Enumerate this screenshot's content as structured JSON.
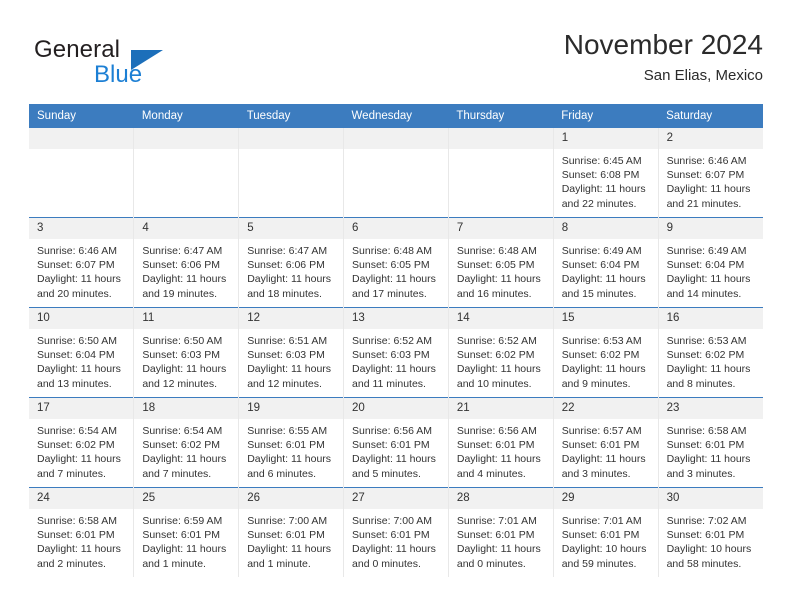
{
  "brand": {
    "name_top": "General",
    "name_bottom": "Blue",
    "triangle_color": "#1c6fba",
    "blue_text_color": "#1c7fd4"
  },
  "header": {
    "title": "November 2024",
    "subtitle": "San Elias, Mexico"
  },
  "theme": {
    "header_blue": "#3c7cbf",
    "daynum_bg": "#f1f1f1",
    "cell_text": "#333333"
  },
  "weekdays": [
    "Sunday",
    "Monday",
    "Tuesday",
    "Wednesday",
    "Thursday",
    "Friday",
    "Saturday"
  ],
  "weeks": [
    [
      {
        "day": "",
        "sunrise": "",
        "sunset": "",
        "daylight1": "",
        "daylight2": ""
      },
      {
        "day": "",
        "sunrise": "",
        "sunset": "",
        "daylight1": "",
        "daylight2": ""
      },
      {
        "day": "",
        "sunrise": "",
        "sunset": "",
        "daylight1": "",
        "daylight2": ""
      },
      {
        "day": "",
        "sunrise": "",
        "sunset": "",
        "daylight1": "",
        "daylight2": ""
      },
      {
        "day": "",
        "sunrise": "",
        "sunset": "",
        "daylight1": "",
        "daylight2": ""
      },
      {
        "day": "1",
        "sunrise": "Sunrise: 6:45 AM",
        "sunset": "Sunset: 6:08 PM",
        "daylight1": "Daylight: 11 hours",
        "daylight2": "and 22 minutes."
      },
      {
        "day": "2",
        "sunrise": "Sunrise: 6:46 AM",
        "sunset": "Sunset: 6:07 PM",
        "daylight1": "Daylight: 11 hours",
        "daylight2": "and 21 minutes."
      }
    ],
    [
      {
        "day": "3",
        "sunrise": "Sunrise: 6:46 AM",
        "sunset": "Sunset: 6:07 PM",
        "daylight1": "Daylight: 11 hours",
        "daylight2": "and 20 minutes."
      },
      {
        "day": "4",
        "sunrise": "Sunrise: 6:47 AM",
        "sunset": "Sunset: 6:06 PM",
        "daylight1": "Daylight: 11 hours",
        "daylight2": "and 19 minutes."
      },
      {
        "day": "5",
        "sunrise": "Sunrise: 6:47 AM",
        "sunset": "Sunset: 6:06 PM",
        "daylight1": "Daylight: 11 hours",
        "daylight2": "and 18 minutes."
      },
      {
        "day": "6",
        "sunrise": "Sunrise: 6:48 AM",
        "sunset": "Sunset: 6:05 PM",
        "daylight1": "Daylight: 11 hours",
        "daylight2": "and 17 minutes."
      },
      {
        "day": "7",
        "sunrise": "Sunrise: 6:48 AM",
        "sunset": "Sunset: 6:05 PM",
        "daylight1": "Daylight: 11 hours",
        "daylight2": "and 16 minutes."
      },
      {
        "day": "8",
        "sunrise": "Sunrise: 6:49 AM",
        "sunset": "Sunset: 6:04 PM",
        "daylight1": "Daylight: 11 hours",
        "daylight2": "and 15 minutes."
      },
      {
        "day": "9",
        "sunrise": "Sunrise: 6:49 AM",
        "sunset": "Sunset: 6:04 PM",
        "daylight1": "Daylight: 11 hours",
        "daylight2": "and 14 minutes."
      }
    ],
    [
      {
        "day": "10",
        "sunrise": "Sunrise: 6:50 AM",
        "sunset": "Sunset: 6:04 PM",
        "daylight1": "Daylight: 11 hours",
        "daylight2": "and 13 minutes."
      },
      {
        "day": "11",
        "sunrise": "Sunrise: 6:50 AM",
        "sunset": "Sunset: 6:03 PM",
        "daylight1": "Daylight: 11 hours",
        "daylight2": "and 12 minutes."
      },
      {
        "day": "12",
        "sunrise": "Sunrise: 6:51 AM",
        "sunset": "Sunset: 6:03 PM",
        "daylight1": "Daylight: 11 hours",
        "daylight2": "and 12 minutes."
      },
      {
        "day": "13",
        "sunrise": "Sunrise: 6:52 AM",
        "sunset": "Sunset: 6:03 PM",
        "daylight1": "Daylight: 11 hours",
        "daylight2": "and 11 minutes."
      },
      {
        "day": "14",
        "sunrise": "Sunrise: 6:52 AM",
        "sunset": "Sunset: 6:02 PM",
        "daylight1": "Daylight: 11 hours",
        "daylight2": "and 10 minutes."
      },
      {
        "day": "15",
        "sunrise": "Sunrise: 6:53 AM",
        "sunset": "Sunset: 6:02 PM",
        "daylight1": "Daylight: 11 hours",
        "daylight2": "and 9 minutes."
      },
      {
        "day": "16",
        "sunrise": "Sunrise: 6:53 AM",
        "sunset": "Sunset: 6:02 PM",
        "daylight1": "Daylight: 11 hours",
        "daylight2": "and 8 minutes."
      }
    ],
    [
      {
        "day": "17",
        "sunrise": "Sunrise: 6:54 AM",
        "sunset": "Sunset: 6:02 PM",
        "daylight1": "Daylight: 11 hours",
        "daylight2": "and 7 minutes."
      },
      {
        "day": "18",
        "sunrise": "Sunrise: 6:54 AM",
        "sunset": "Sunset: 6:02 PM",
        "daylight1": "Daylight: 11 hours",
        "daylight2": "and 7 minutes."
      },
      {
        "day": "19",
        "sunrise": "Sunrise: 6:55 AM",
        "sunset": "Sunset: 6:01 PM",
        "daylight1": "Daylight: 11 hours",
        "daylight2": "and 6 minutes."
      },
      {
        "day": "20",
        "sunrise": "Sunrise: 6:56 AM",
        "sunset": "Sunset: 6:01 PM",
        "daylight1": "Daylight: 11 hours",
        "daylight2": "and 5 minutes."
      },
      {
        "day": "21",
        "sunrise": "Sunrise: 6:56 AM",
        "sunset": "Sunset: 6:01 PM",
        "daylight1": "Daylight: 11 hours",
        "daylight2": "and 4 minutes."
      },
      {
        "day": "22",
        "sunrise": "Sunrise: 6:57 AM",
        "sunset": "Sunset: 6:01 PM",
        "daylight1": "Daylight: 11 hours",
        "daylight2": "and 3 minutes."
      },
      {
        "day": "23",
        "sunrise": "Sunrise: 6:58 AM",
        "sunset": "Sunset: 6:01 PM",
        "daylight1": "Daylight: 11 hours",
        "daylight2": "and 3 minutes."
      }
    ],
    [
      {
        "day": "24",
        "sunrise": "Sunrise: 6:58 AM",
        "sunset": "Sunset: 6:01 PM",
        "daylight1": "Daylight: 11 hours",
        "daylight2": "and 2 minutes."
      },
      {
        "day": "25",
        "sunrise": "Sunrise: 6:59 AM",
        "sunset": "Sunset: 6:01 PM",
        "daylight1": "Daylight: 11 hours",
        "daylight2": "and 1 minute."
      },
      {
        "day": "26",
        "sunrise": "Sunrise: 7:00 AM",
        "sunset": "Sunset: 6:01 PM",
        "daylight1": "Daylight: 11 hours",
        "daylight2": "and 1 minute."
      },
      {
        "day": "27",
        "sunrise": "Sunrise: 7:00 AM",
        "sunset": "Sunset: 6:01 PM",
        "daylight1": "Daylight: 11 hours",
        "daylight2": "and 0 minutes."
      },
      {
        "day": "28",
        "sunrise": "Sunrise: 7:01 AM",
        "sunset": "Sunset: 6:01 PM",
        "daylight1": "Daylight: 11 hours",
        "daylight2": "and 0 minutes."
      },
      {
        "day": "29",
        "sunrise": "Sunrise: 7:01 AM",
        "sunset": "Sunset: 6:01 PM",
        "daylight1": "Daylight: 10 hours",
        "daylight2": "and 59 minutes."
      },
      {
        "day": "30",
        "sunrise": "Sunrise: 7:02 AM",
        "sunset": "Sunset: 6:01 PM",
        "daylight1": "Daylight: 10 hours",
        "daylight2": "and 58 minutes."
      }
    ]
  ]
}
